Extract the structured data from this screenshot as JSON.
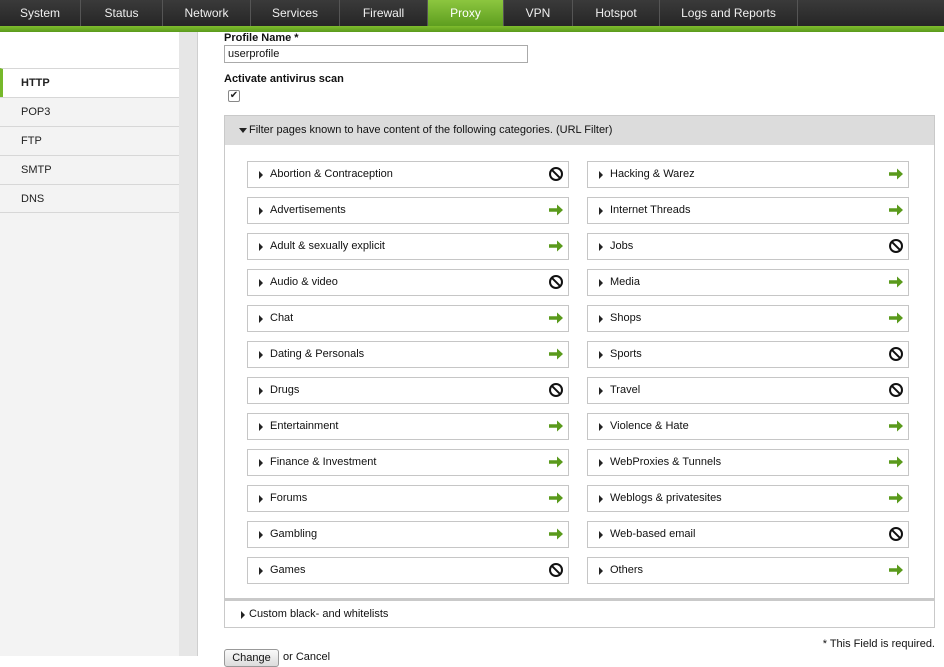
{
  "nav": {
    "tabs": [
      {
        "label": "System"
      },
      {
        "label": "Status"
      },
      {
        "label": "Network"
      },
      {
        "label": "Services"
      },
      {
        "label": "Firewall"
      },
      {
        "label": "Proxy"
      },
      {
        "label": "VPN"
      },
      {
        "label": "Hotspot"
      },
      {
        "label": "Logs and Reports"
      }
    ],
    "active": "Proxy"
  },
  "sidebar": {
    "items": [
      {
        "label": "HTTP"
      },
      {
        "label": "POP3"
      },
      {
        "label": "FTP"
      },
      {
        "label": "SMTP"
      },
      {
        "label": "DNS"
      }
    ],
    "active": "HTTP"
  },
  "form": {
    "profile_name_label": "Profile Name *",
    "profile_name_value": "userprofile",
    "antivirus_label": "Activate antivirus scan",
    "antivirus_checked": true,
    "url_filter_header": "Filter pages known to have content of the following categories. (URL Filter)",
    "custom_lists_label": "Custom black- and whitelists",
    "required_note": "* This Field is required.",
    "change_button": "Change",
    "or_text": "or",
    "cancel_link": "Cancel"
  },
  "categories_left": [
    {
      "label": "Abortion & Contraception",
      "action": "block"
    },
    {
      "label": "Advertisements",
      "action": "allow"
    },
    {
      "label": "Adult & sexually explicit",
      "action": "allow"
    },
    {
      "label": "Audio & video",
      "action": "block"
    },
    {
      "label": "Chat",
      "action": "allow"
    },
    {
      "label": "Dating & Personals",
      "action": "allow"
    },
    {
      "label": "Drugs",
      "action": "block"
    },
    {
      "label": "Entertainment",
      "action": "allow"
    },
    {
      "label": "Finance & Investment",
      "action": "allow"
    },
    {
      "label": "Forums",
      "action": "allow"
    },
    {
      "label": "Gambling",
      "action": "allow"
    },
    {
      "label": "Games",
      "action": "block"
    }
  ],
  "categories_right": [
    {
      "label": "Hacking & Warez",
      "action": "allow"
    },
    {
      "label": "Internet Threads",
      "action": "allow"
    },
    {
      "label": "Jobs",
      "action": "block"
    },
    {
      "label": "Media",
      "action": "allow"
    },
    {
      "label": "Shops",
      "action": "allow"
    },
    {
      "label": "Sports",
      "action": "block"
    },
    {
      "label": "Travel",
      "action": "block"
    },
    {
      "label": "Violence & Hate",
      "action": "allow"
    },
    {
      "label": "WebProxies & Tunnels",
      "action": "allow"
    },
    {
      "label": "Weblogs & privatesites",
      "action": "allow"
    },
    {
      "label": "Web-based email",
      "action": "block"
    },
    {
      "label": "Others",
      "action": "allow"
    }
  ],
  "icons": {
    "allow": "arrow-right-icon",
    "block": "block-icon"
  },
  "colors": {
    "accent": "#76b82a",
    "allow_arrow": "#5a9a1c",
    "block_icon": "#111111"
  }
}
